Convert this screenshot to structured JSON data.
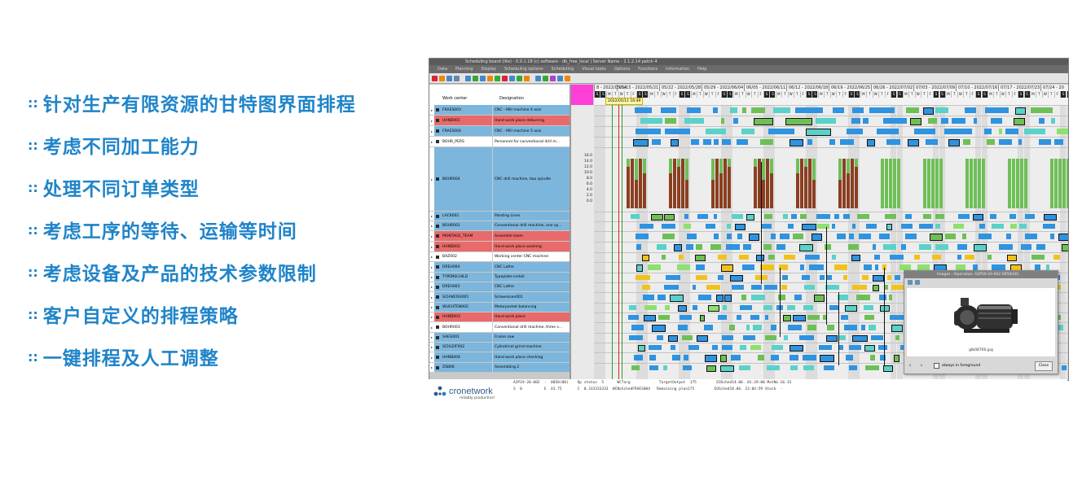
{
  "features": [
    {
      "prefix": "::",
      "text": "针对生产有限资源的甘特图界面排程"
    },
    {
      "prefix": "::",
      "text": "考虑不同加工能力"
    },
    {
      "prefix": "::",
      "text": "处理不同订单类型"
    },
    {
      "prefix": "::",
      "text": "考虑工序的等待、运输等时间"
    },
    {
      "prefix": "::",
      "text": "考虑设备及产品的技术参数限制"
    },
    {
      "prefix": "::",
      "text": "客户自定义的排程策略"
    },
    {
      "prefix": "::",
      "text": "一键排程及人工调整"
    }
  ],
  "window": {
    "title": "Scheduling board (lite) - 0.0.1.18 (c) software - db_free_local | Server Name - 2.1.2.14 patch 4",
    "menus": [
      "Data",
      "Planning",
      "Display",
      "Scheduling options",
      "Scheduling",
      "Visual tasks",
      "Options",
      "Functions",
      "Information",
      "Help"
    ]
  },
  "columns": {
    "work_center": "Work center",
    "designation": "Designation"
  },
  "weeks": [
    "8 - 2022/05/14",
    "05/15 - 2022/05/21",
    "05/22 - 2022/05/28",
    "05/29 - 2022/06/04",
    "06/05 - 2022/06/11",
    "06/12 - 2022/06/18",
    "06/19 - 2022/06/25",
    "06/26 - 2022/07/02",
    "07/03 - 2022/07/09",
    "07/10 - 2022/07/16",
    "07/17 - 2022/07/23",
    "07/24 - 20"
  ],
  "day_letters": [
    "S",
    "M",
    "T",
    "W",
    "T",
    "F",
    "S"
  ],
  "timestamp": "2022/05/11 16:49",
  "axis_ticks": [
    "16.0",
    "14.0",
    "12.0",
    "10.0",
    "8.0",
    "6.0",
    "4.0",
    "2.0",
    "0.0"
  ],
  "rows": [
    {
      "wc": "FRAES003",
      "ds": "CNC - Mill machine 4 axis",
      "color": "#7cb6dc"
    },
    {
      "wc": "HAND001",
      "ds": "Hand work place deburring",
      "color": "#e86a6a"
    },
    {
      "wc": "FRAES004",
      "ds": "CNC - Mill machine 5 axis",
      "color": "#7cb6dc"
    },
    {
      "wc": "BOHR_PERS",
      "ds": "Personnel for conventional drill m...",
      "color": "#ffffff"
    },
    {
      "wc": "BOHR004",
      "ds": "CNC drill machine, two spindle",
      "color": "#7cb6dc"
    },
    {
      "wc": "LACK002",
      "ds": "Painting Lines",
      "color": "#7cb6dc"
    },
    {
      "wc": "BOHR001",
      "ds": "Conventional drill machine, one sp...",
      "color": "#7cb6dc"
    },
    {
      "wc": "MONTAGE_TEAM",
      "ds": "Assemble team",
      "color": "#e86a6a"
    },
    {
      "wc": "HAND002",
      "ds": "Hand work place washing",
      "color": "#e86a6a"
    },
    {
      "wc": "BAZ002",
      "ds": "Working center CNC machine",
      "color": "#ffffff"
    },
    {
      "wc": "DREH004",
      "ds": "CNC Lathe",
      "color": "#7cb6dc"
    },
    {
      "wc": "TYPENSCHILD",
      "ds": "Typeplate install",
      "color": "#7cb6dc"
    },
    {
      "wc": "DREH003",
      "ds": "CNC Lathe",
      "color": "#7cb6dc"
    },
    {
      "wc": "SCHWEISS001",
      "ds": "Schweissen001",
      "color": "#7cb6dc"
    },
    {
      "wc": "WUCHTEN002",
      "ds": "Motorpacket balancing",
      "color": "#7cb6dc"
    },
    {
      "wc": "HAND003",
      "ds": "Hand work place",
      "color": "#e86a6a"
    },
    {
      "wc": "BOHR003",
      "ds": "Conventional drill machine, three s...",
      "color": "#ffffff"
    },
    {
      "wc": "SAEG001",
      "ds": "Frame saw",
      "color": "#7cb6dc"
    },
    {
      "wc": "SCHLEIF002",
      "ds": "Cylindrical grind machine",
      "color": "#7cb6dc"
    },
    {
      "wc": "HAND004",
      "ds": "Hand work place checking",
      "color": "#7cb6dc"
    },
    {
      "wc": "ZSB06",
      "ds": "Assembling 2",
      "color": "#7cb6dc"
    }
  ],
  "popup": {
    "title": "Images - Operation: A2P19-20-002 0050(00)",
    "filename": "glb08760.jpg",
    "checkbox": "always in foreground",
    "close": "Close"
  },
  "status": {
    "logo": "cronetwork",
    "tagline": "reliably productive!",
    "line1": "A2P19-20-002  -  0050(00)    Op status  5      WCTarg             TargetOutput  175         EOSched14.06. 01:29:00 MatNo GG-15",
    "line2": "S  0          E  43.75       C  0.333333333  WCNoSchedFRAES004   Remaining plan175         EOSched18.06. 23:04:59 Stock  -"
  },
  "colors": {
    "feature_blue": "#1f84c9",
    "row_blue": "#7cb6dc",
    "row_red": "#e86a6a",
    "bar_blue": "#2f93df",
    "bar_brown": "#8b3f22",
    "bar_green": "#6fbf57"
  }
}
